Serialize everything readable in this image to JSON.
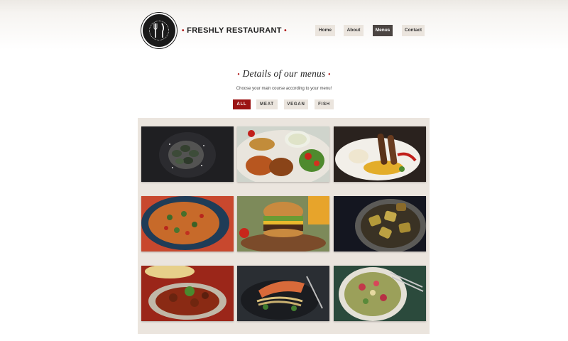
{
  "header": {
    "brand": "FRESHLY RESTAURANT",
    "nav": [
      "Home",
      "About",
      "Menus",
      "Contact"
    ],
    "active_nav": "Menus"
  },
  "section": {
    "title": "Details of our menus",
    "subtitle": "Choose your main course according to your menu!"
  },
  "filters": {
    "items": [
      "ALL",
      "MEAT",
      "VEGAN",
      "FISH"
    ],
    "active": "ALL"
  },
  "gallery": {
    "items": [
      "mussels-dish-image",
      "grilled-platter-image",
      "kebab-rice-image",
      "pasta-skillet-image",
      "burger-image",
      "grilled-eggplant-image",
      "stew-image",
      "salmon-noodles-image",
      "salad-bowl-image"
    ]
  },
  "colors": {
    "accent": "#9b1414",
    "active_nav": "#4b4542",
    "button_bg": "#ebe5de",
    "gallery_bg": "#ebe5de"
  }
}
